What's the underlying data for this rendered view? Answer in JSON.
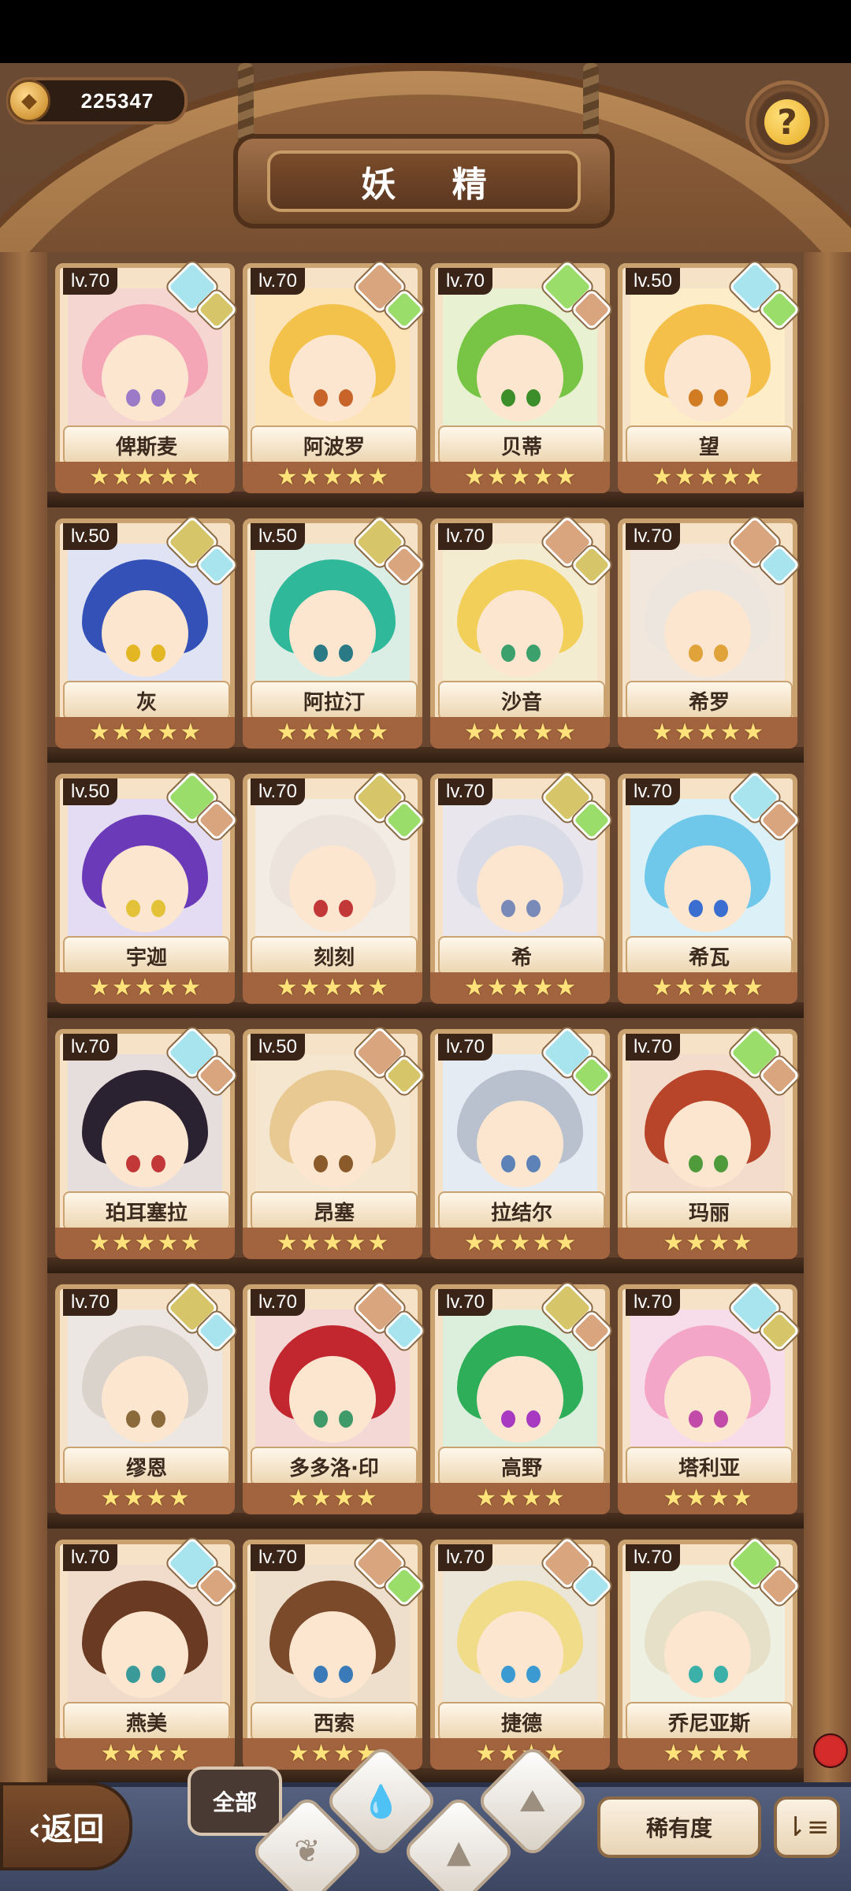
{
  "header": {
    "coin_value": "225347",
    "title": "妖 精",
    "help_label": "?"
  },
  "cards": [
    {
      "level": "lv.70",
      "name": "俾斯麦",
      "stars": 5,
      "elem": "#a7e4ee",
      "elem2": "#d7c56a",
      "hair": "#f4a6b6",
      "eye": "#9b7bc7",
      "bg": "#f6d6d0"
    },
    {
      "level": "lv.70",
      "name": "阿波罗",
      "stars": 5,
      "elem": "#d9a57e",
      "elem2": "#9bdd6a",
      "hair": "#f2c24a",
      "eye": "#c8642a",
      "bg": "#fde3b8"
    },
    {
      "level": "lv.70",
      "name": "贝蒂",
      "stars": 5,
      "elem": "#9bdd6a",
      "elem2": "#d9a57e",
      "hair": "#78c545",
      "eye": "#3b8e2a",
      "bg": "#e8f2d2"
    },
    {
      "level": "lv.50",
      "name": "望",
      "stars": 5,
      "elem": "#a7e4ee",
      "elem2": "#9bdd6a",
      "hair": "#f5c04a",
      "eye": "#d17c23",
      "bg": "#fdeec9"
    },
    {
      "level": "lv.50",
      "name": "灰",
      "stars": 5,
      "elem": "#d7c56a",
      "elem2": "#a7e4ee",
      "hair": "#3451b8",
      "eye": "#e3b623",
      "bg": "#dfe3f4"
    },
    {
      "level": "lv.50",
      "name": "阿拉汀",
      "stars": 5,
      "elem": "#d7c56a",
      "elem2": "#d9a57e",
      "hair": "#2fb89a",
      "eye": "#2a7a86",
      "bg": "#dbeee5"
    },
    {
      "level": "lv.70",
      "name": "沙音",
      "stars": 5,
      "elem": "#d9a57e",
      "elem2": "#d7c56a",
      "hair": "#f1cf58",
      "eye": "#3ba06b",
      "bg": "#f4ecd0"
    },
    {
      "level": "lv.70",
      "name": "希罗",
      "stars": 5,
      "elem": "#d9a57e",
      "elem2": "#a7e4ee",
      "hair": "#ece6df",
      "eye": "#e0a33a",
      "bg": "#f1e7dc"
    },
    {
      "level": "lv.50",
      "name": "宇迦",
      "stars": 5,
      "elem": "#9bdd6a",
      "elem2": "#d9a57e",
      "hair": "#6a3ab8",
      "eye": "#e3c23a",
      "bg": "#e4dcf2"
    },
    {
      "level": "lv.70",
      "name": "刻刻",
      "stars": 5,
      "elem": "#d7c56a",
      "elem2": "#9bdd6a",
      "hair": "#ebe3dc",
      "eye": "#c23838",
      "bg": "#f3ece4"
    },
    {
      "level": "lv.70",
      "name": "希",
      "stars": 5,
      "elem": "#d7c56a",
      "elem2": "#9bdd6a",
      "hair": "#d9dce6",
      "eye": "#7a8ab8",
      "bg": "#e9e6ee"
    },
    {
      "level": "lv.70",
      "name": "希瓦",
      "stars": 5,
      "elem": "#a7e4ee",
      "elem2": "#d9a57e",
      "hair": "#6fc8ea",
      "eye": "#3a6fd1",
      "bg": "#dcf0f8"
    },
    {
      "level": "lv.70",
      "name": "珀耳塞拉",
      "stars": 5,
      "elem": "#a7e4ee",
      "elem2": "#d9a57e",
      "hair": "#2a2230",
      "eye": "#c23838",
      "bg": "#e6dedd"
    },
    {
      "level": "lv.50",
      "name": "昂塞",
      "stars": 5,
      "elem": "#d9a57e",
      "elem2": "#d7c56a",
      "hair": "#e9c992",
      "eye": "#8a5a2a",
      "bg": "#f4e6cf"
    },
    {
      "level": "lv.70",
      "name": "拉结尔",
      "stars": 5,
      "elem": "#a7e4ee",
      "elem2": "#9bdd6a",
      "hair": "#b9c1cf",
      "eye": "#5c82b8",
      "bg": "#e5ebf2"
    },
    {
      "level": "lv.70",
      "name": "玛丽",
      "stars": 4,
      "elem": "#9bdd6a",
      "elem2": "#d9a57e",
      "hair": "#b8452a",
      "eye": "#4f9a3a",
      "bg": "#f4dccc"
    },
    {
      "level": "lv.70",
      "name": "缪恩",
      "stars": 4,
      "elem": "#d7c56a",
      "elem2": "#a7e4ee",
      "hair": "#d9d3cc",
      "eye": "#8a6a3a",
      "bg": "#ece7e2"
    },
    {
      "level": "lv.70",
      "name": "多多洛·印",
      "stars": 4,
      "elem": "#d9a57e",
      "elem2": "#a7e4ee",
      "hair": "#c2262e",
      "eye": "#3f9a6a",
      "bg": "#f4d8d6"
    },
    {
      "level": "lv.70",
      "name": "高野",
      "stars": 4,
      "elem": "#d7c56a",
      "elem2": "#d9a57e",
      "hair": "#2fae5a",
      "eye": "#a83ac2",
      "bg": "#dcefdc"
    },
    {
      "level": "lv.70",
      "name": "塔利亚",
      "stars": 4,
      "elem": "#a7e4ee",
      "elem2": "#d7c56a",
      "hair": "#f4a6c8",
      "eye": "#c24aa8",
      "bg": "#f6dde9"
    },
    {
      "level": "lv.70",
      "name": "燕美",
      "stars": 4,
      "elem": "#a7e4ee",
      "elem2": "#d9a57e",
      "hair": "#6b3a22",
      "eye": "#3a9a9a",
      "bg": "#f1dccb"
    },
    {
      "level": "lv.70",
      "name": "西索",
      "stars": 4,
      "elem": "#d9a57e",
      "elem2": "#9bdd6a",
      "hair": "#7a4a2a",
      "eye": "#3a7ab8",
      "bg": "#eedfcc"
    },
    {
      "level": "lv.70",
      "name": "捷德",
      "stars": 4,
      "elem": "#d9a57e",
      "elem2": "#a7e4ee",
      "hair": "#f1dc8a",
      "eye": "#3a9ad1",
      "bg": "#ece6d8"
    },
    {
      "level": "lv.70",
      "name": "乔尼亚斯",
      "stars": 4,
      "elem": "#9bdd6a",
      "elem2": "#d9a57e",
      "hair": "#e6e0c8",
      "eye": "#3ab0a8",
      "bg": "#eef0e2"
    }
  ],
  "bottom": {
    "back_label": "‹返回",
    "tab_all_label": "全部",
    "rarity_label": "稀有度",
    "sort_glyph": "⇂≡"
  }
}
